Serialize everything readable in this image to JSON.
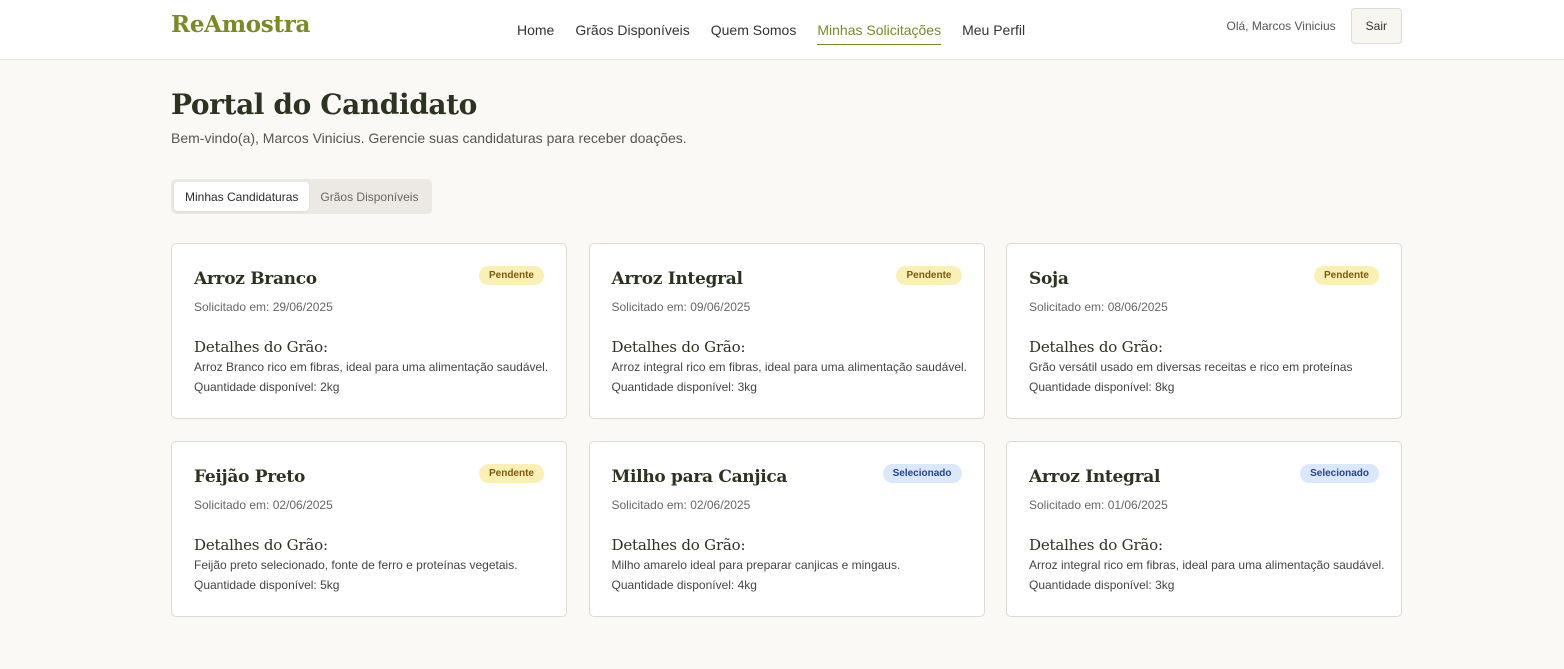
{
  "header": {
    "brand": "ReAmostra",
    "nav": [
      {
        "label": "Home",
        "active": false
      },
      {
        "label": "Grãos Disponíveis",
        "active": false
      },
      {
        "label": "Quem Somos",
        "active": false
      },
      {
        "label": "Minhas Solicitações",
        "active": true
      },
      {
        "label": "Meu Perfil",
        "active": false
      }
    ],
    "greeting": "Olá, Marcos Vinicius",
    "logout_label": "Sair"
  },
  "page": {
    "title": "Portal do Candidato",
    "subtitle": "Bem-vindo(a), Marcos Vinicius. Gerencie suas candidaturas para receber doações."
  },
  "tabs": [
    {
      "label": "Minhas Candidaturas",
      "active": true
    },
    {
      "label": "Grãos Disponíveis",
      "active": false
    }
  ],
  "cards": [
    {
      "title": "Arroz Branco",
      "status": "Pendente",
      "status_key": "pendente",
      "date": "Solicitado em: 29/06/2025",
      "section": "Detalhes do Grão:",
      "description": "Arroz Branco rico em fibras, ideal para uma alimentação saudável.",
      "quantity": "Quantidade disponível: 2kg"
    },
    {
      "title": "Arroz Integral",
      "status": "Pendente",
      "status_key": "pendente",
      "date": "Solicitado em: 09/06/2025",
      "section": "Detalhes do Grão:",
      "description": "Arroz integral rico em fibras, ideal para uma alimentação saudável.",
      "quantity": "Quantidade disponível: 3kg"
    },
    {
      "title": "Soja",
      "status": "Pendente",
      "status_key": "pendente",
      "date": "Solicitado em: 08/06/2025",
      "section": "Detalhes do Grão:",
      "description": "Grão versátil usado em diversas receitas e rico em proteínas",
      "quantity": "Quantidade disponível: 8kg"
    },
    {
      "title": "Feijão Preto",
      "status": "Pendente",
      "status_key": "pendente",
      "date": "Solicitado em: 02/06/2025",
      "section": "Detalhes do Grão:",
      "description": "Feijão preto selecionado, fonte de ferro e proteínas vegetais.",
      "quantity": "Quantidade disponível: 5kg"
    },
    {
      "title": "Milho para Canjica",
      "status": "Selecionado",
      "status_key": "selecionado",
      "date": "Solicitado em: 02/06/2025",
      "section": "Detalhes do Grão:",
      "description": "Milho amarelo ideal para preparar canjicas e mingaus.",
      "quantity": "Quantidade disponível: 4kg"
    },
    {
      "title": "Arroz Integral",
      "status": "Selecionado",
      "status_key": "selecionado",
      "date": "Solicitado em: 01/06/2025",
      "section": "Detalhes do Grão:",
      "description": "Arroz integral rico em fibras, ideal para uma alimentação saudável.",
      "quantity": "Quantidade disponível: 3kg"
    }
  ],
  "colors": {
    "accent": "#7c8a23",
    "background": "#faf9f5",
    "badge_pendente_bg": "#fbf0b4",
    "badge_selecionado_bg": "#dbe7fb"
  }
}
